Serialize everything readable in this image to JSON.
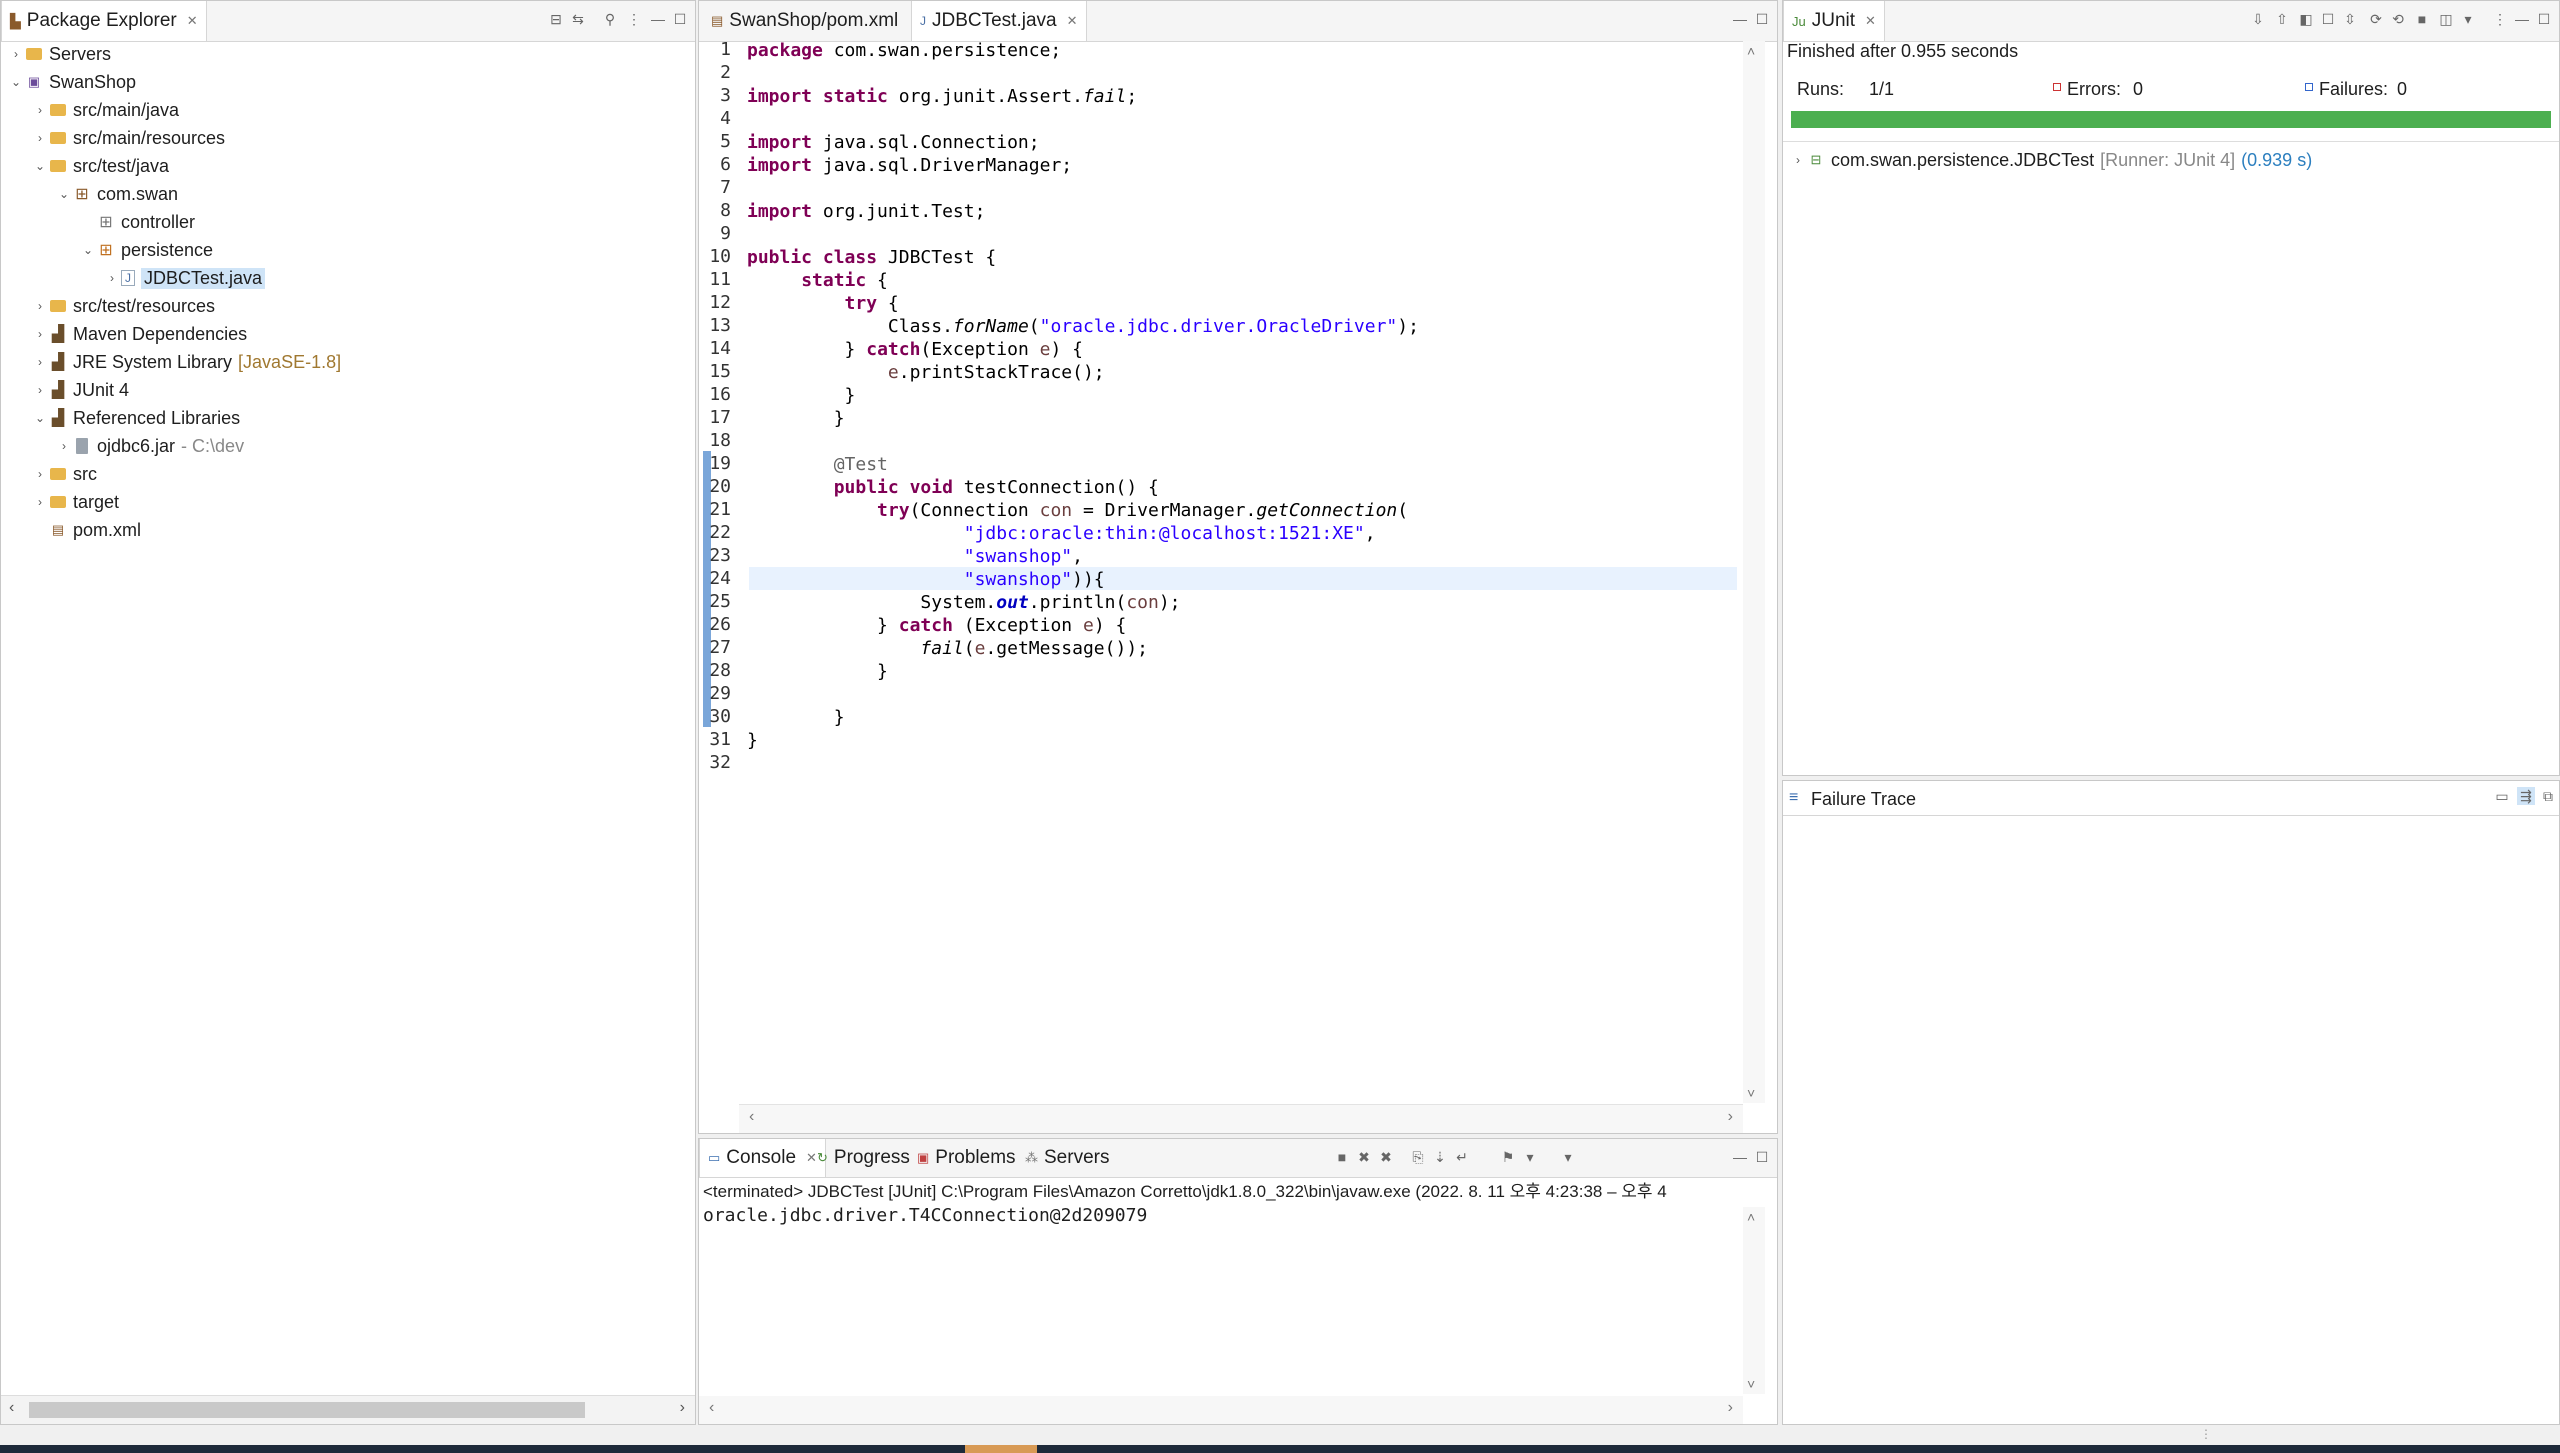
{
  "package_explorer": {
    "title": "Package Explorer",
    "items": [
      {
        "label": "Servers",
        "deco": ""
      },
      {
        "label": "SwanShop",
        "deco": ""
      },
      {
        "label": "src/main/java",
        "deco": ""
      },
      {
        "label": "src/main/resources",
        "deco": ""
      },
      {
        "label": "src/test/java",
        "deco": ""
      },
      {
        "label": "com.swan",
        "deco": ""
      },
      {
        "label": "controller",
        "deco": ""
      },
      {
        "label": "persistence",
        "deco": ""
      },
      {
        "label": "JDBCTest.java",
        "deco": ""
      },
      {
        "label": "src/test/resources",
        "deco": ""
      },
      {
        "label": "Maven Dependencies",
        "deco": ""
      },
      {
        "label": "JRE System Library",
        "deco": "[JavaSE-1.8]"
      },
      {
        "label": "JUnit 4",
        "deco": ""
      },
      {
        "label": "Referenced Libraries",
        "deco": ""
      },
      {
        "label": "ojdbc6.jar",
        "deco": "- C:\\dev"
      },
      {
        "label": "src",
        "deco": ""
      },
      {
        "label": "target",
        "deco": ""
      },
      {
        "label": "pom.xml",
        "deco": ""
      }
    ]
  },
  "editor": {
    "tabs": [
      "SwanShop/pom.xml",
      "JDBCTest.java"
    ],
    "line_numbers": [
      "1",
      "2",
      "3",
      "4",
      "5",
      "6",
      "7",
      "8",
      "9",
      "10",
      "11",
      "12",
      "13",
      "14",
      "15",
      "16",
      "17",
      "18",
      "19",
      "20",
      "21",
      "22",
      "23",
      "24",
      "25",
      "26",
      "27",
      "28",
      "29",
      "30",
      "31",
      "32"
    ],
    "code": {
      "l1_kw": "package",
      "l1_rest": " com.swan.persistence;",
      "l3_kw1": "import",
      "l3_kw2": " static",
      "l3_a": " org.junit.Assert.",
      "l3_b": "fail",
      "l3_c": ";",
      "l5_kw": "import",
      "l5_rest": " java.sql.Connection;",
      "l6_kw": "import",
      "l6_rest": " java.sql.DriverManager;",
      "l8_kw": "import",
      "l8_rest": " org.junit.Test;",
      "l10_kw1": "public",
      "l10_kw2": " class",
      "l10_rest": " JDBCTest {",
      "l11_kw": "static",
      "l11_rest": " {",
      "l12_kw": "try",
      "l12_rest": " {",
      "l13_a": "Class.",
      "l13_b": "forName",
      "l13_c": "(",
      "l13_str": "\"oracle.jdbc.driver.OracleDriver\"",
      "l13_d": ");",
      "l14_a": "} ",
      "l14_kw": "catch",
      "l14_b": "(Exception ",
      "l14_v": "e",
      "l14_c": ") {",
      "l15_v": "e",
      "l15_rest": ".printStackTrace();",
      "l16": "}",
      "l17": "}",
      "l19": "@Test",
      "l20_kw1": "public",
      "l20_kw2": " void",
      "l20_rest": " testConnection() {",
      "l21_kw": "try",
      "l21_a": "(Connection ",
      "l21_v": "con",
      "l21_b": " = DriverManager.",
      "l21_c": "getConnection",
      "l21_d": "(",
      "l22_str": "\"jdbc:oracle:thin:@localhost:1521:XE\"",
      "l22_rest": ",",
      "l23_str": "\"swanshop\"",
      "l23_rest": ",",
      "l24_str": "\"swanshop\"",
      "l24_rest": ")){",
      "l25_a": "System.",
      "l25_b": "out",
      "l25_c": ".println(",
      "l25_v": "con",
      "l25_d": ");",
      "l26_a": "} ",
      "l26_kw": "catch",
      "l26_b": " (Exception ",
      "l26_v": "e",
      "l26_c": ") {",
      "l27_a": "fail",
      "l27_b": "(",
      "l27_v": "e",
      "l27_c": ".getMessage());",
      "l28": "}",
      "l30": "}",
      "l31": "}"
    }
  },
  "console": {
    "tabs": [
      "Console",
      "Progress",
      "Problems",
      "Servers"
    ],
    "header": "<terminated> JDBCTest [JUnit] C:\\Program Files\\Amazon Corretto\\jdk1.8.0_322\\bin\\javaw.exe  (2022. 8. 11 오후 4:23:38 – 오후 4",
    "output": "oracle.jdbc.driver.T4CConnection@2d209079"
  },
  "junit": {
    "title": "JUnit",
    "finished": "Finished after 0.955 seconds",
    "runs_label": "Runs:",
    "runs_value": "1/1",
    "errors_label": "Errors:",
    "errors_value": "0",
    "failures_label": "Failures:",
    "failures_value": "0",
    "progress": 1.0,
    "progress_color": "#4caf50",
    "test_name": "com.swan.persistence.JDBCTest",
    "test_runner": "[Runner: JUnit 4]",
    "test_time": "(0.939 s)",
    "failure_trace_title": "Failure Trace"
  }
}
